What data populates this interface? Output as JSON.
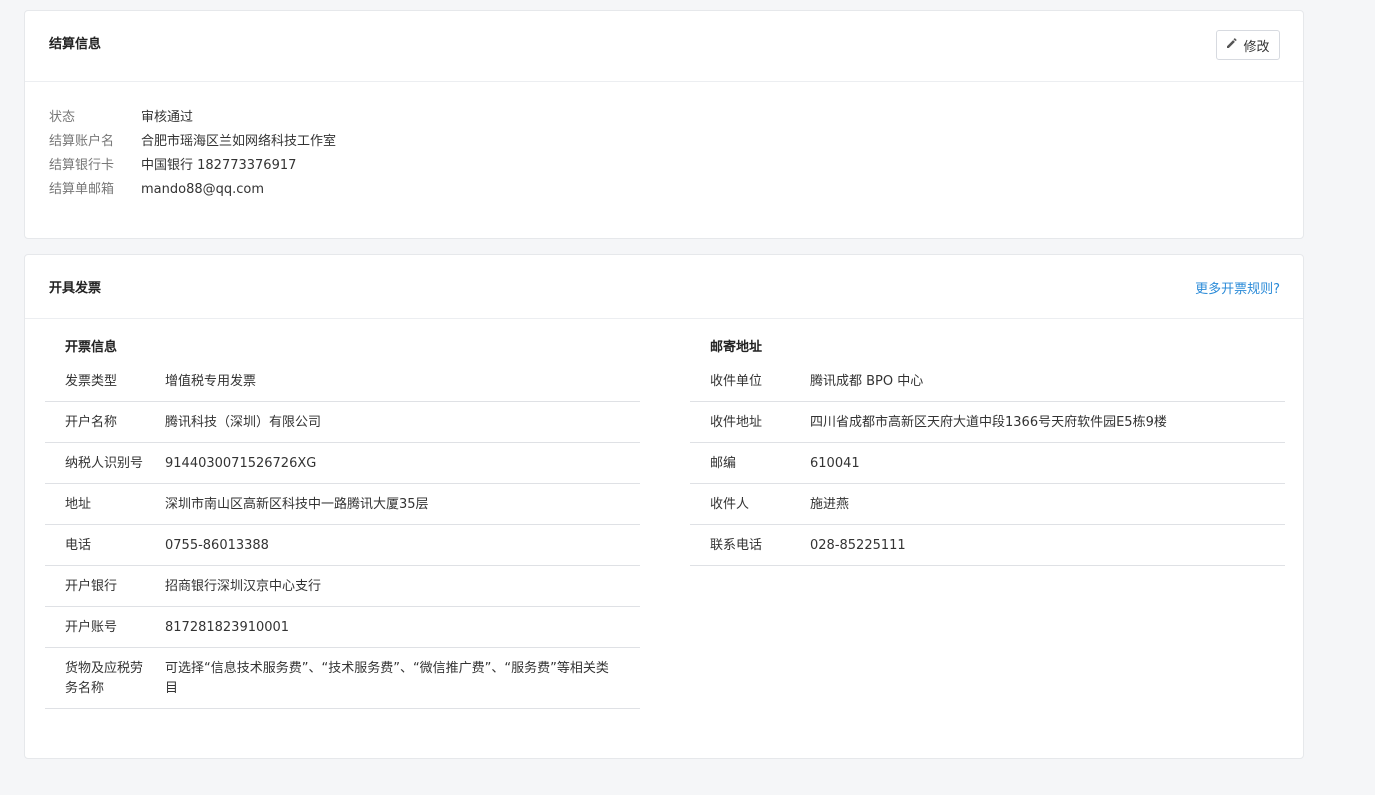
{
  "settlement": {
    "title": "结算信息",
    "edit_label": "修改",
    "rows": [
      {
        "label": "状态",
        "value": "审核通过"
      },
      {
        "label": "结算账户名",
        "value": "合肥市瑶海区兰如网络科技工作室"
      },
      {
        "label": "结算银行卡",
        "value": "中国银行 182773376917"
      },
      {
        "label": "结算单邮箱",
        "value": "mando88@qq.com"
      }
    ]
  },
  "invoice": {
    "title": "开具发票",
    "rules_link": "更多开票规则?",
    "info_section": {
      "title": "开票信息",
      "rows": [
        {
          "label": "发票类型",
          "value": "增值税专用发票"
        },
        {
          "label": "开户名称",
          "value": "腾讯科技（深圳）有限公司"
        },
        {
          "label": "纳税人识别号",
          "value": "9144030071526726XG"
        },
        {
          "label": "地址",
          "value": "深圳市南山区高新区科技中一路腾讯大厦35层"
        },
        {
          "label": "电话",
          "value": "0755-86013388"
        },
        {
          "label": "开户银行",
          "value": "招商银行深圳汉京中心支行"
        },
        {
          "label": "开户账号",
          "value": "817281823910001"
        },
        {
          "label": "货物及应税劳务名称",
          "value": "可选择“信息技术服务费”、“技术服务费”、“微信推广费”、“服务费”等相关类目"
        }
      ]
    },
    "mail_section": {
      "title": "邮寄地址",
      "rows": [
        {
          "label": "收件单位",
          "value": "腾讯成都 BPO 中心"
        },
        {
          "label": "收件地址",
          "value": "四川省成都市高新区天府大道中段1366号天府软件园E5栋9楼"
        },
        {
          "label": "邮编",
          "value": "610041"
        },
        {
          "label": "收件人",
          "value": "施进燕"
        },
        {
          "label": "联系电话",
          "value": "028-85225111"
        }
      ]
    }
  },
  "icons": {
    "edit": "pencil-icon"
  }
}
